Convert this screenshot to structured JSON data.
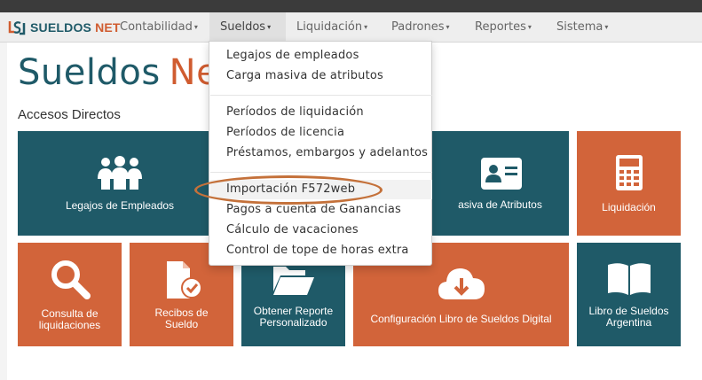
{
  "brand": {
    "name_part1": "SUELDOS",
    "name_part2": "NET"
  },
  "nav": {
    "items": [
      {
        "label": "Contabilidad",
        "active": false
      },
      {
        "label": "Sueldos",
        "active": true
      },
      {
        "label": "Liquidación",
        "active": false
      },
      {
        "label": "Padrones",
        "active": false
      },
      {
        "label": "Reportes",
        "active": false
      },
      {
        "label": "Sistema",
        "active": false
      }
    ]
  },
  "main": {
    "title_part1": "Sueldos",
    "title_part2": "Net",
    "section_label": "Accesos Directos"
  },
  "tiles": [
    {
      "label": "Legajos de Empleados",
      "icon": "users-group-icon",
      "color": "#1f5a68"
    },
    {
      "label": "Carga Masiva de Atributos",
      "visible_label": "asiva de Atributos",
      "icon": "id-card-icon",
      "color": "#1f5a68"
    },
    {
      "label": "Liquidación",
      "icon": "calculator-icon",
      "color": "#d2643a"
    },
    {
      "label_line1": "Consulta de",
      "label_line2": "liquidaciones",
      "icon": "search-icon",
      "color": "#d2643a"
    },
    {
      "label_line1": "Recibos de",
      "label_line2": "Sueldo",
      "icon": "file-check-icon",
      "color": "#d2643a"
    },
    {
      "label_line1": "Obtener Reporte",
      "label_line2": "Personalizado",
      "icon": "folder-open-icon",
      "color": "#1f5a68"
    },
    {
      "label": "Configuración Libro de Sueldos Digital",
      "icon": "cloud-download-icon",
      "color": "#d2643a"
    },
    {
      "label_line1": "Libro de Sueldos",
      "label_line2": "Argentina",
      "icon": "book-icon",
      "color": "#1f5a68"
    }
  ],
  "dropdown": {
    "groups": [
      [
        "Legajos de empleados",
        "Carga masiva de atributos"
      ],
      [
        "Períodos de liquidación",
        "Períodos de licencia",
        "Préstamos, embargos y adelantos"
      ],
      [
        "Importación F572web",
        "Pagos a cuenta de Ganancias",
        "Cálculo de vacaciones",
        "Control de tope de horas extra"
      ]
    ],
    "highlighted": "Importación F572web"
  },
  "colors": {
    "teal": "#1f5a68",
    "orange": "#d2643a",
    "annotation": "#c4713a"
  }
}
